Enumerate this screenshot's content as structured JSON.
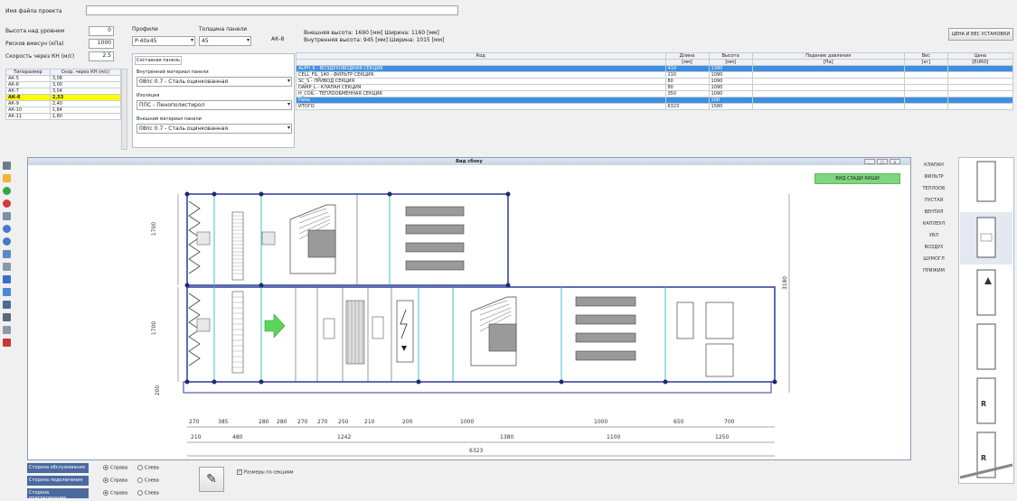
{
  "top": {
    "file_label": "Имя файла проекта",
    "file_value": ""
  },
  "params": {
    "rows": [
      {
        "label": "Высота над уровнем",
        "value": "0"
      },
      {
        "label": "Рисков вмесун (кПа)",
        "value": "1000"
      },
      {
        "label": "Скорость через КН (м/с)",
        "value": "2.5"
      }
    ]
  },
  "profile": {
    "profile_label": "Профили",
    "profile_value": "P-40x45",
    "panel_label": "Толщина панели",
    "panel_value": "45",
    "ak_label": "АК-8"
  },
  "size_table": {
    "headers": [
      "Типоразмер",
      "Скор. через КН (м/с)"
    ],
    "rows": [
      [
        "АК-5",
        "3,08"
      ],
      [
        "АК-6",
        "3,00"
      ],
      [
        "АК-7",
        "3,04"
      ],
      [
        "АК-8",
        "2,53"
      ],
      [
        "АК-9",
        "2,40"
      ],
      [
        "АК-10",
        "1,84"
      ],
      [
        "АК-11",
        "1,80"
      ]
    ]
  },
  "panel_tab": "Составная панель",
  "materials": {
    "inner_label": "Внутренний материал панели",
    "inner_value": "08пс 0.7 - Сталь оцинкованная",
    "insul_label": "Изоляция",
    "insul_value": "ППС - Пенополистирол",
    "outer_label": "Внешний материал панели",
    "outer_value": "08пс 0.7 - Сталь оцинкованная"
  },
  "info": {
    "line1": "Внешняя высота: 1690 [мм]   Ширина: 1160 [мм]",
    "line2": "Внутренняя высота: 945 [мм]   Ширина: 1015 [мм]"
  },
  "parts_table": {
    "headers": [
      "Код",
      "Длина",
      "Высота",
      "Падение давления",
      "Вес",
      "Цена"
    ],
    "units": [
      "",
      "[мм]",
      "[мм]",
      "[Па]",
      "[кг]",
      "[EURO]"
    ],
    "rows": [
      [
        "ALPH_K - ВОЗДУХОВОДНАЯ СЕКЦИЯ",
        "410",
        "1390",
        "",
        "",
        ""
      ],
      [
        "CELL_FIL_140 - ФИЛЬТР СЕКЦИЯ",
        "210",
        "1090",
        "",
        "",
        ""
      ],
      [
        "SC_S - ПРИВОД СЕКЦИЯ",
        "80",
        "1090",
        "",
        "",
        ""
      ],
      [
        "DAMP_L - КЛАПАН СЕКЦИЯ",
        "80",
        "1090",
        "",
        "",
        ""
      ],
      [
        "H_COIL - ТЕПЛООБМЕННАЯ СЕКЦИЯ",
        "350",
        "1090",
        "",
        "",
        ""
      ],
      [
        "Рама",
        "",
        "100",
        "",
        "",
        ""
      ],
      [
        "ИТОГО",
        "6323",
        "1580",
        "",
        "",
        ""
      ]
    ]
  },
  "buttons": {
    "calc": "ЦЕНА И ВЕС УСТАНОВКИ",
    "add_section": "ВИД СЗАДИ КИШИ"
  },
  "drawing": {
    "title": "Вид сбоку",
    "dim_top": [
      "270",
      "385",
      "280",
      "280",
      "270",
      "270",
      "250",
      "210",
      "200",
      "1000",
      "1000",
      "650",
      "700"
    ],
    "dim_mid": [
      "210",
      "480",
      "1242",
      "1380",
      "1100",
      "1250"
    ],
    "dim_total": "6323",
    "dim_h1": "1700",
    "dim_h2": "1700",
    "dim_h3": "200",
    "dim_right": "3180"
  },
  "components": [
    "КЛАПАН",
    "ФИЛЬТР",
    "ТЕПЛООБ",
    "ПУСТАЯ",
    "ВЕНТИЛ",
    "КАПЛЕУЛ",
    "УВЛ",
    "ВОЗДУХ",
    "ШУМОГЛ",
    "ПРИЖИМ"
  ],
  "bottom": {
    "side_label": "Сторона обслуживания",
    "side_opt1": "Справа",
    "side_opt2": "Слева",
    "side2_label": "Сторона подключения",
    "side2_opt1": "Справа",
    "side2_opt2": "Слева",
    "side3_label": "Сторона присоединения",
    "side3_opt1": "Справа",
    "side3_opt2": "Слева",
    "checkbox_label": "Размеры по секциям"
  },
  "colors": {
    "selected_row": "#3d8fe0",
    "highlight_yellow": "#ffff00",
    "frame_blue": "#2a3a9a",
    "cyan_line": "#35c6c6",
    "green_button": "#7ed67e"
  }
}
